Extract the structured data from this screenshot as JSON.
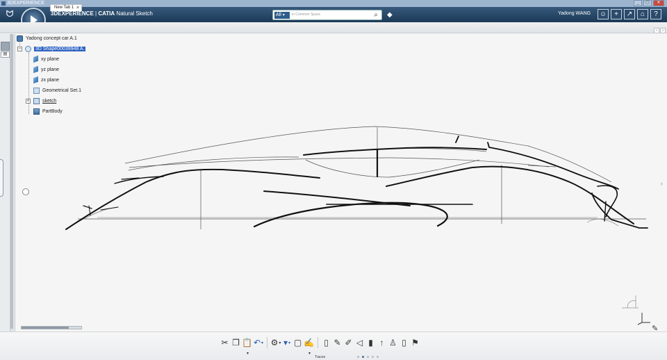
{
  "os": {
    "title": "3DEXPERIENCE",
    "controls": [
      "_",
      "▢",
      "✕"
    ]
  },
  "header": {
    "brand_prefix": "3DEXPERIENCE",
    "brand_sep": " | ",
    "brand_app": "CATIA",
    "brand_role": " Natural Sketch",
    "search_scope": "All",
    "search_placeholder": "in Common Space",
    "user": "Yadong WANG",
    "buttons": [
      "user-icon",
      "plus-icon",
      "share-icon",
      "home-icon",
      "help-icon"
    ],
    "button_glyphs": [
      "☺",
      "+",
      "↗",
      "⌂",
      "?"
    ]
  },
  "tabs": [
    {
      "label": "New Tab 1",
      "close": "×"
    }
  ],
  "tab_nav": [
    "‹",
    "›"
  ],
  "tree": {
    "root": "Yadong concept car A.1",
    "shape": "3D Shape00039948 A.",
    "children": [
      {
        "label": "xy plane",
        "icon": "plane-icon"
      },
      {
        "label": "yz plane",
        "icon": "plane-icon"
      },
      {
        "label": "zx plane",
        "icon": "plane-icon"
      },
      {
        "label": "Geometrical Set.1",
        "icon": "geometrical-set-icon"
      },
      {
        "label": "sketch",
        "icon": "sketch-icon"
      },
      {
        "label": "PartBody",
        "icon": "part-body-icon"
      }
    ]
  },
  "toolbar": {
    "tools": [
      {
        "name": "cut-icon",
        "glyph": "✂"
      },
      {
        "name": "copy-icon",
        "glyph": "❐"
      },
      {
        "name": "paste-icon",
        "glyph": "📋"
      },
      {
        "name": "undo-icon",
        "glyph": "↶"
      },
      {
        "name": "settings-icon",
        "glyph": "⚙"
      },
      {
        "name": "paint-icon",
        "glyph": "▾"
      },
      {
        "name": "frame-icon",
        "glyph": "▢"
      },
      {
        "name": "brush-icon",
        "glyph": "✍"
      },
      {
        "name": "doc-icon",
        "glyph": "▯"
      },
      {
        "name": "pencil-icon",
        "glyph": "✎"
      },
      {
        "name": "pen-icon",
        "glyph": "✐"
      },
      {
        "name": "cone-icon",
        "glyph": "◁"
      },
      {
        "name": "marker-icon",
        "glyph": "▮"
      },
      {
        "name": "arrow-up-icon",
        "glyph": "↑"
      },
      {
        "name": "figure-icon",
        "glyph": "♙"
      },
      {
        "name": "eraser-icon",
        "glyph": "▯"
      },
      {
        "name": "sweep-icon",
        "glyph": "⚑"
      }
    ],
    "section_label": "Traces"
  }
}
